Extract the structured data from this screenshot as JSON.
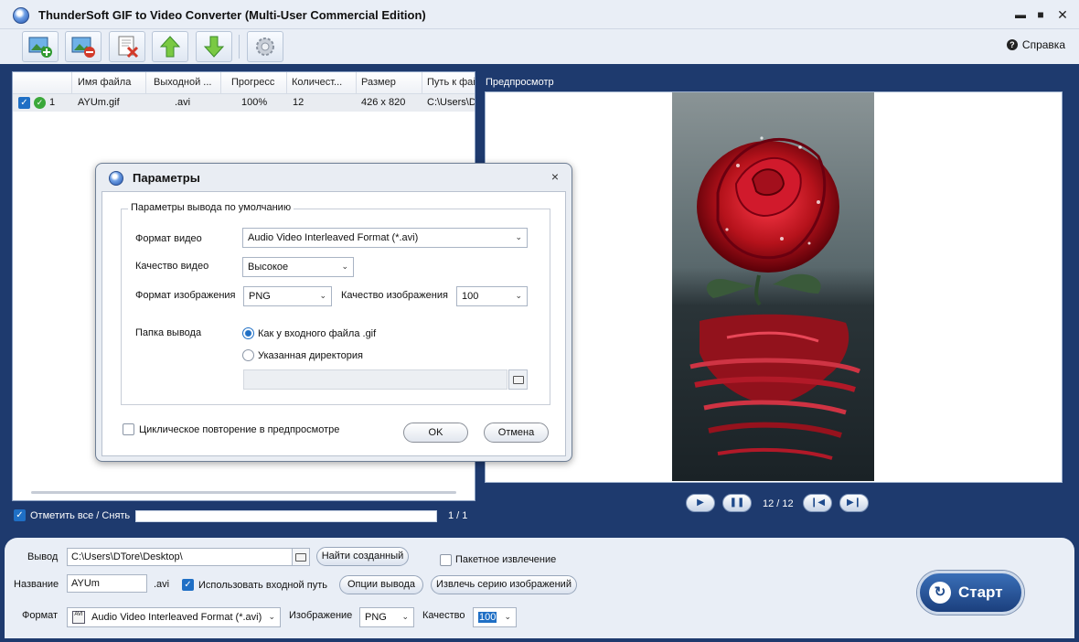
{
  "window": {
    "title": "ThunderSoft GIF to Video Converter (Multi-User Commercial Edition)"
  },
  "toolbar": {
    "help_label": "Справка"
  },
  "file_list": {
    "columns": [
      "Имя файла",
      "Выходной ...",
      "Прогресс",
      "Количест...",
      "Размер",
      "Путь к фай"
    ],
    "rows": [
      {
        "index": "1",
        "name": "AYUm.gif",
        "output": ".avi",
        "progress": "100%",
        "count": "12",
        "size": "426 x 820",
        "path": "C:\\Users\\D"
      }
    ]
  },
  "preview": {
    "label": "Предпросмотр",
    "frame_counter": "12 / 12"
  },
  "selection": {
    "select_all_label": "Отметить все / Снять",
    "count": "1 / 1"
  },
  "output": {
    "label": "Вывод",
    "path": "C:\\Users\\DTore\\Desktop\\",
    "find_button": "Найти созданный",
    "batch_extract_label": "Пакетное извлечение",
    "name_label": "Название",
    "name_value": "AYUm",
    "ext": ".avi",
    "use_input_path_label": "Использовать входной путь",
    "output_options_button": "Опции вывода",
    "extract_series_button": "Извлечь серию изображений",
    "format_label": "Формат",
    "format_value": "Audio Video Interleaved Format (*.avi)",
    "image_label": "Изображение",
    "image_value": "PNG",
    "quality_label": "Качество",
    "quality_value": "100",
    "start_button": "Старт"
  },
  "dialog": {
    "title": "Параметры",
    "group_title": "Параметры вывода по умолчанию",
    "video_format_label": "Формат видео",
    "video_format_value": "Audio Video Interleaved Format (*.avi)",
    "video_quality_label": "Качество видео",
    "video_quality_value": "Высокое",
    "image_format_label": "Формат изображения",
    "image_format_value": "PNG",
    "image_quality_label": "Качество изображения",
    "image_quality_value": "100",
    "output_folder_label": "Папка вывода",
    "radio_same": "Как у входного файла .gif",
    "radio_custom": "Указанная директория",
    "loop_preview_label": "Циклическое повторение в предпросмотре",
    "ok_button": "OK",
    "cancel_button": "Отмена"
  },
  "colors": {
    "frame": "#1e3a6e",
    "accent": "#1f6fc5",
    "rose": "#b5121b"
  }
}
